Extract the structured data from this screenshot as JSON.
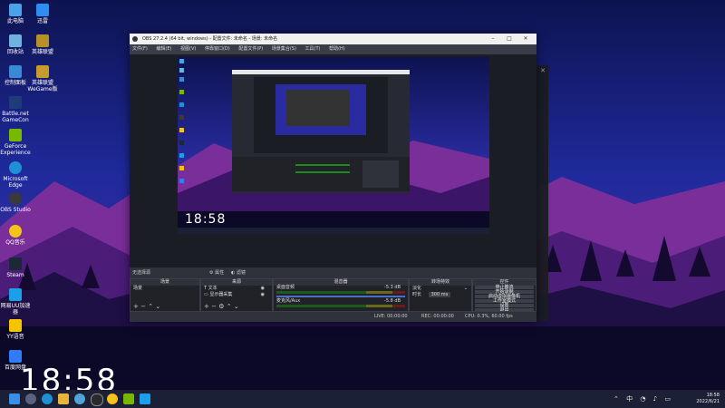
{
  "desktop": {
    "icons": [
      {
        "label": "此电脑",
        "color": "#4aa3e8"
      },
      {
        "label": "回收站",
        "color": "#6fb2e0"
      },
      {
        "label": "控制面板",
        "color": "#3b89d6"
      },
      {
        "label": "Battle.net GameCon",
        "color": "#1e3c7a"
      },
      {
        "label": "GeForce Experience",
        "color": "#76b900"
      },
      {
        "label": "Microsoft Edge",
        "color": "#1f8fd6"
      },
      {
        "label": "OBS Studio",
        "color": "#3a3a3a"
      },
      {
        "label": "QQ音乐",
        "color": "#f3c21b"
      },
      {
        "label": "Steam",
        "color": "#1b2838"
      },
      {
        "label": "网易UU加速器",
        "color": "#1aa0e8"
      },
      {
        "label": "YY语音",
        "color": "#f5c400"
      },
      {
        "label": "百度网盘",
        "color": "#2f7cf6"
      }
    ],
    "icons_right": [
      {
        "label": "迅雷",
        "color": "#2b8ef0"
      },
      {
        "label": "英雄联盟",
        "color": "#b8902a"
      },
      {
        "label": "英雄联盟 WeGame版",
        "color": "#c79c2e"
      }
    ],
    "clock": "18:58"
  },
  "obs": {
    "title": "OBS 27.2.4 (64 bit, windows) - 配置文件: 未命名 - 场景: 未命名",
    "menu": [
      "文件(F)",
      "编辑(E)",
      "视图(V)",
      "停靠窗口(D)",
      "配置文件(P)",
      "场景集合(S)",
      "工具(T)",
      "帮助(H)"
    ],
    "preview_clock": "18:58",
    "context_bar": {
      "label": "无选择源",
      "props": "属性",
      "filters": "滤镜"
    },
    "scenes": {
      "header": "场景",
      "items": [
        "场景"
      ]
    },
    "sources": {
      "header": "来源",
      "items": [
        "文本",
        "显示器采集"
      ]
    },
    "mixer": {
      "header": "混音器",
      "channels": [
        {
          "name": "桌面音频",
          "db": "-5.3 dB"
        },
        {
          "name": "麦克风/Aux",
          "db": "-5.8 dB"
        }
      ]
    },
    "transitions": {
      "header": "转场特效",
      "type": "淡化",
      "duration_label": "时长",
      "duration": "300 ms"
    },
    "controls": {
      "header": "控件",
      "buttons": [
        "停止推流",
        "开始录制",
        "启动虚拟摄像机",
        "工作室模式",
        "设置",
        "退出"
      ]
    },
    "status": {
      "live": "LIVE: 00:00:00",
      "rec": "REC: 00:00:00",
      "cpu": "CPU: 0.3%, 60.00 fps"
    }
  },
  "taskbar": {
    "time": "18:58",
    "date": "2022/6/21",
    "tray_text": "中"
  }
}
